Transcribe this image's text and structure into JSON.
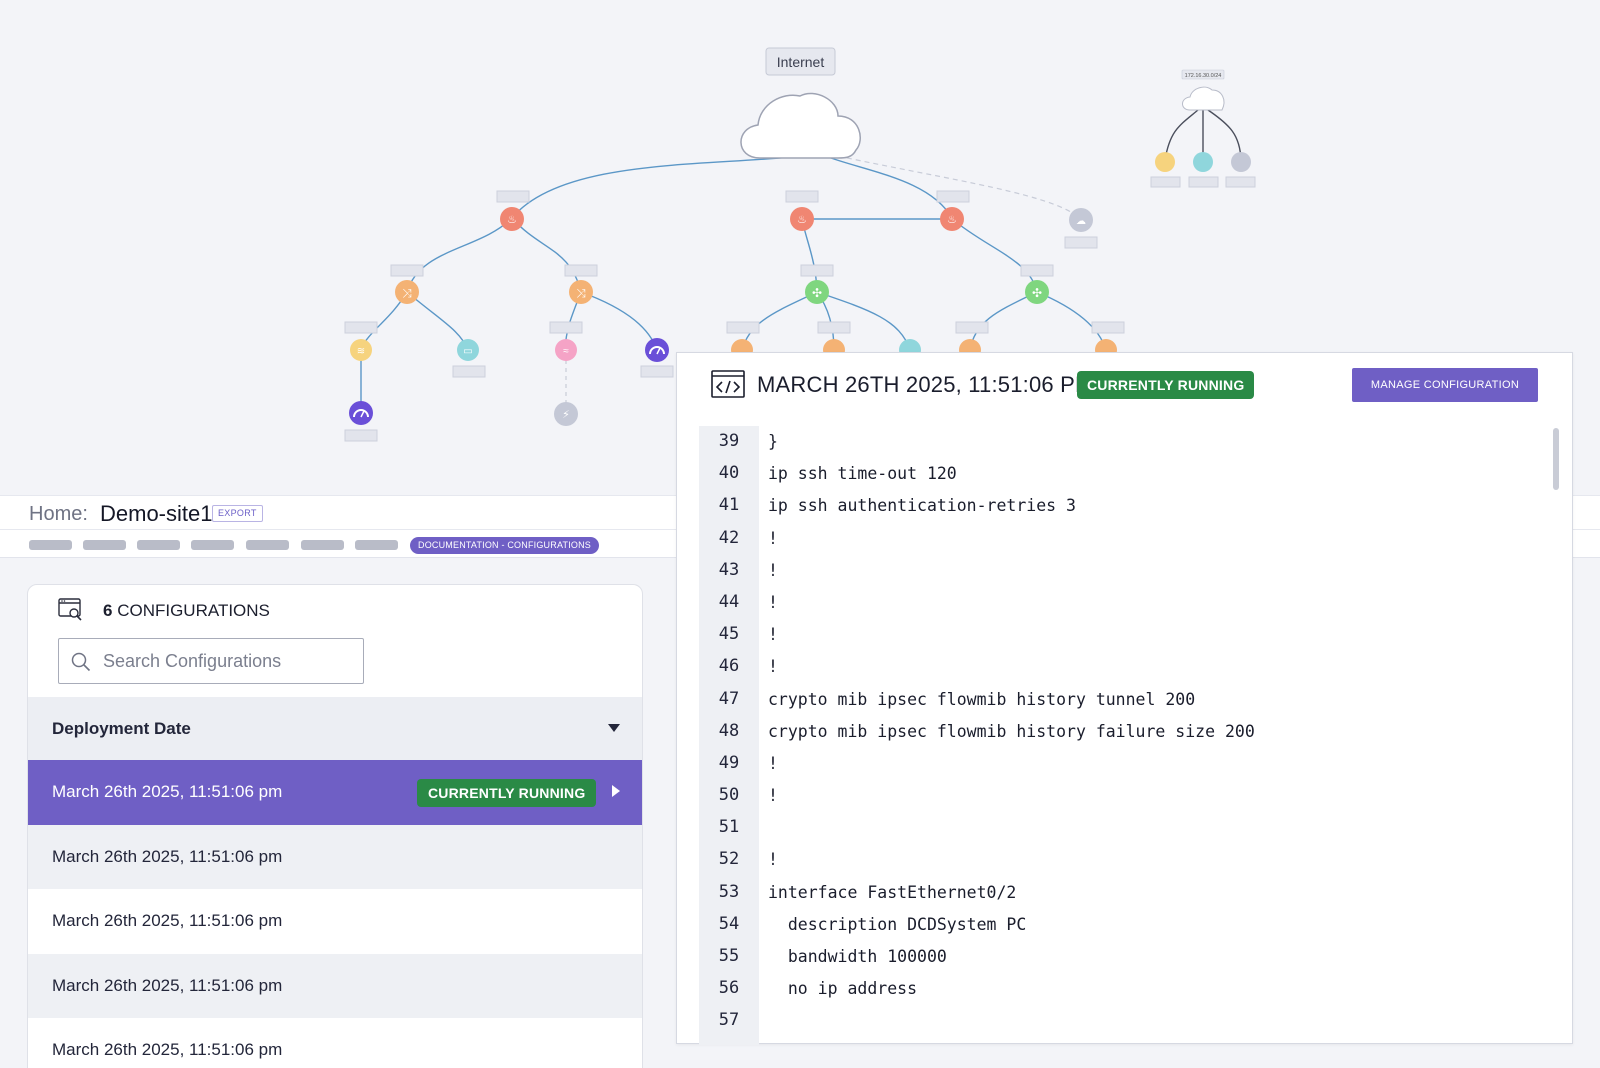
{
  "topology": {
    "internet_label": "Internet",
    "secondary_cloud_label": "172.16.30.0/24"
  },
  "breadcrumb": {
    "home_label": "Home:",
    "site_name": "Demo-site1",
    "export_label": "EXPORT"
  },
  "tabs": {
    "active_label": "DOCUMENTATION - CONFIGURATIONS"
  },
  "configurations": {
    "count": "6",
    "count_label": "CONFIGURATIONS",
    "search_placeholder": "Search Configurations",
    "sort_label": "Deployment Date",
    "rows": [
      {
        "date": "March 26th 2025, 11:51:06 pm",
        "badge": "CURRENTLY RUNNING"
      },
      {
        "date": "March 26th 2025, 11:51:06 pm"
      },
      {
        "date": "March 26th 2025, 11:51:06 pm"
      },
      {
        "date": "March 26th 2025, 11:51:06 pm"
      },
      {
        "date": "March 26th 2025, 11:51:06 pm"
      }
    ]
  },
  "viewer": {
    "title": "MARCH 26TH 2025, 11:51:06 PM",
    "badge": "CURRENTLY RUNNING",
    "manage_button": "MANAGE CONFIGURATION",
    "lines": [
      {
        "no": "39",
        "text": "}"
      },
      {
        "no": "40",
        "text": "ip ssh time-out 120"
      },
      {
        "no": "41",
        "text": "ip ssh authentication-retries 3"
      },
      {
        "no": "42",
        "text": "!"
      },
      {
        "no": "43",
        "text": "!"
      },
      {
        "no": "44",
        "text": "!"
      },
      {
        "no": "45",
        "text": "!"
      },
      {
        "no": "46",
        "text": "!"
      },
      {
        "no": "47",
        "text": "crypto mib ipsec flowmib history tunnel 200"
      },
      {
        "no": "48",
        "text": "crypto mib ipsec flowmib history failure size 200"
      },
      {
        "no": "49",
        "text": "!"
      },
      {
        "no": "50",
        "text": "!"
      },
      {
        "no": "51",
        "text": ""
      },
      {
        "no": "52",
        "text": "!"
      },
      {
        "no": "53",
        "text": "interface FastEthernet0/2"
      },
      {
        "no": "54",
        "text": "  description DCDSystem PC"
      },
      {
        "no": "55",
        "text": "  bandwidth 100000"
      },
      {
        "no": "56",
        "text": "  no ip address"
      },
      {
        "no": "57",
        "text": ""
      }
    ]
  },
  "colors": {
    "accent": "#6f5fc5",
    "running": "#2a8a46",
    "firewall": "#f08672",
    "switch": "#f4b274",
    "router": "#7fd67f",
    "server": "#f6d37e",
    "workstation": "#8fd6dc",
    "wifi": "#f5a3c6",
    "gauge": "#6a4fd8",
    "inactive": "#c4c8d6"
  }
}
